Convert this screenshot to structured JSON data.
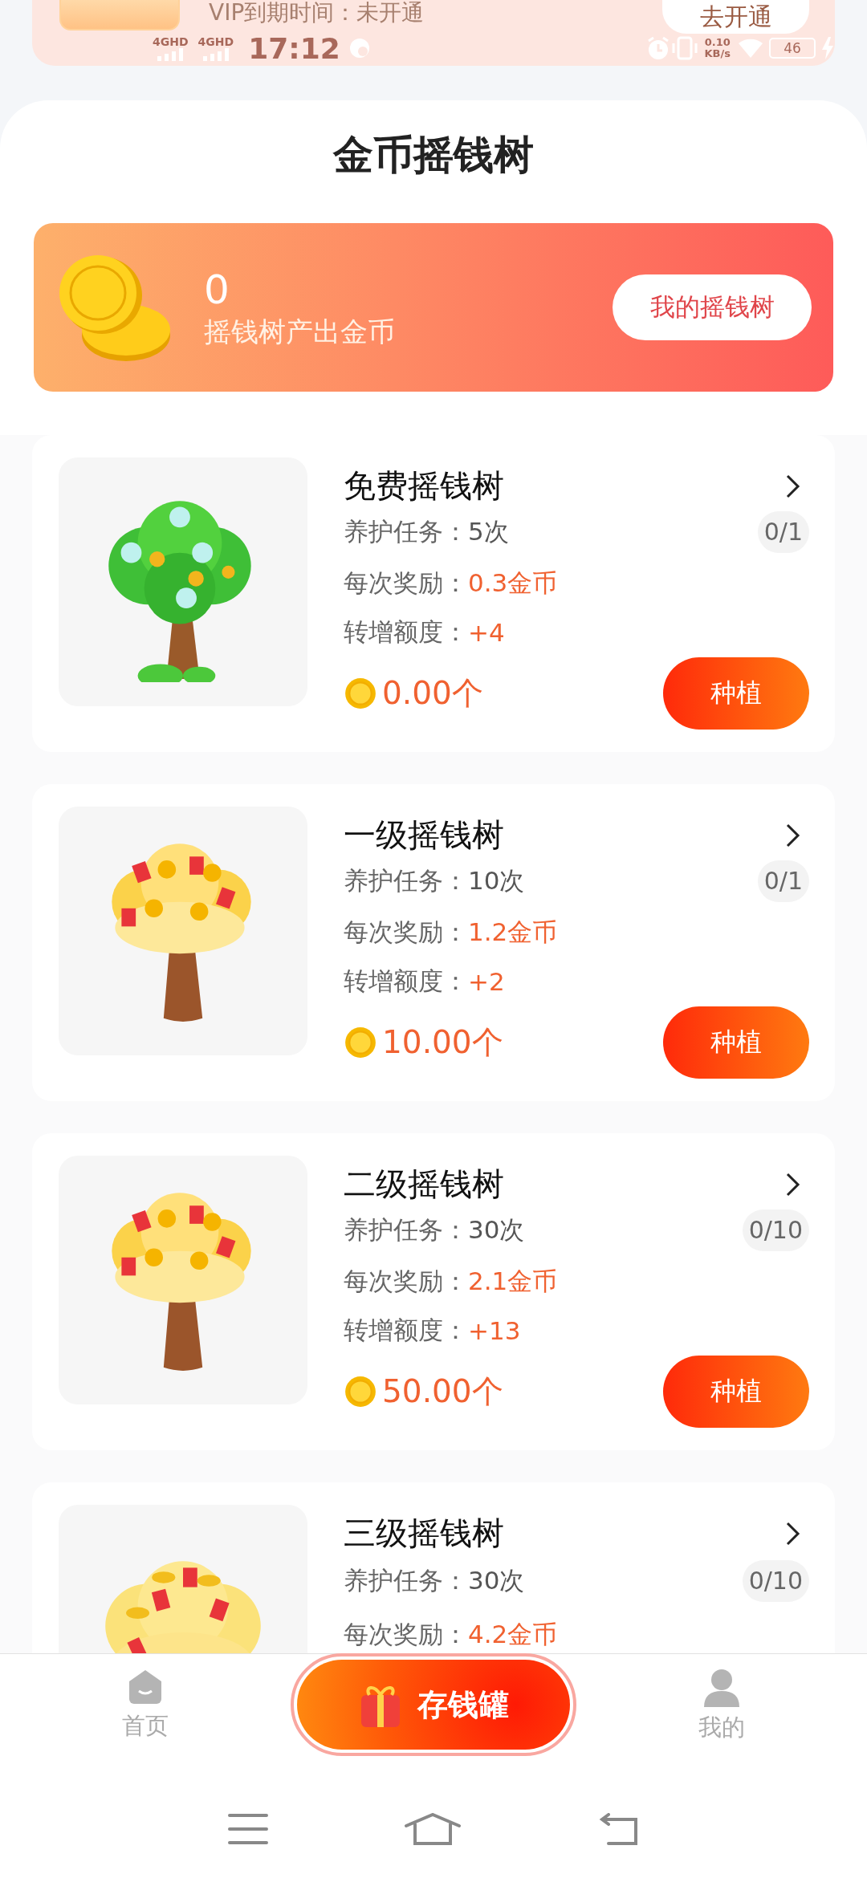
{
  "vip_card": {
    "expiry_text": "VIP到期时间：未开通",
    "button": "去开通"
  },
  "status_bar": {
    "network_labels": [
      "4GHD",
      "4GHD"
    ],
    "time": "17:12",
    "speed_value": "0.10",
    "speed_unit": "KB/s",
    "battery": "46"
  },
  "title": "金币摇钱树",
  "banner": {
    "amount": "0",
    "label": "摇钱树产出金币",
    "button": "我的摇钱树"
  },
  "trees": [
    {
      "kind": "green",
      "name": "免费摇钱树",
      "task_label": "养护任务：",
      "task_value": "5次",
      "progress": "0/1",
      "reward_label": "每次奖励：",
      "reward_value": "0.3金币",
      "quota_label": "转增额度：",
      "quota_value": "+4",
      "price": "0.00个",
      "button": "种植"
    },
    {
      "kind": "packet",
      "name": "一级摇钱树",
      "task_label": "养护任务：",
      "task_value": "10次",
      "progress": "0/1",
      "reward_label": "每次奖励：",
      "reward_value": "1.2金币",
      "quota_label": "转增额度：",
      "quota_value": "+2",
      "price": "10.00个",
      "button": "种植"
    },
    {
      "kind": "packet",
      "name": "二级摇钱树",
      "task_label": "养护任务：",
      "task_value": "30次",
      "progress": "0/10",
      "reward_label": "每次奖励：",
      "reward_value": "2.1金币",
      "quota_label": "转增额度：",
      "quota_value": "+13",
      "price": "50.00个",
      "button": "种植"
    },
    {
      "kind": "ingot",
      "name": "三级摇钱树",
      "task_label": "养护任务：",
      "task_value": "30次",
      "progress": "0/10",
      "reward_label": "每次奖励：",
      "reward_value": "4.2金币"
    }
  ],
  "bottom_nav": [
    {
      "kind": "home",
      "label": "首页"
    },
    {
      "kind": "center",
      "label": "存钱罐"
    },
    {
      "kind": "profile",
      "label": "我的"
    }
  ]
}
